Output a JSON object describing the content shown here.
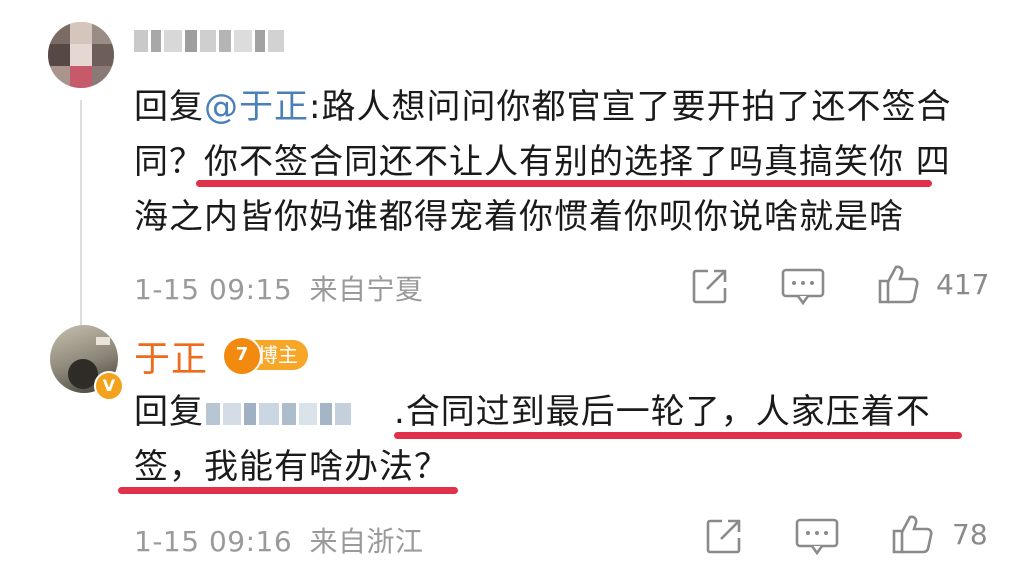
{
  "comment1": {
    "username_masked": "",
    "reply_prefix": "回复",
    "mention": "@于正",
    "line1_rest": ":路人想问问你都官宣了要开拍了还不签合",
    "line2_a": "同？",
    "line2_b": "你不签合同还不让人有别的选择了吗真搞笑你",
    "line2_c": " 四",
    "line3": "海之内皆你妈谁都得宠着你惯着你呗你说啥就是啥",
    "timestamp": "1-15 09:15",
    "source": "来自宁夏",
    "likes": "417"
  },
  "comment2": {
    "username": "于正",
    "badge_label": "博主",
    "badge_icon_text": "7",
    "verified_icon_text": "V",
    "reply_prefix": "回复",
    "line1_rest": ".合同过到最后一轮了，人家压着不",
    "line2": "签，我能有啥办法？",
    "timestamp": "1-15 09:16",
    "source": "来自浙江",
    "likes": "78"
  },
  "colors": {
    "mention": "#4a7fb8",
    "underline": "#e0304a",
    "username_orange": "#f06a1d",
    "meta_gray": "#9a9a9a"
  },
  "icons": [
    "share-icon",
    "comment-icon",
    "like-icon"
  ]
}
